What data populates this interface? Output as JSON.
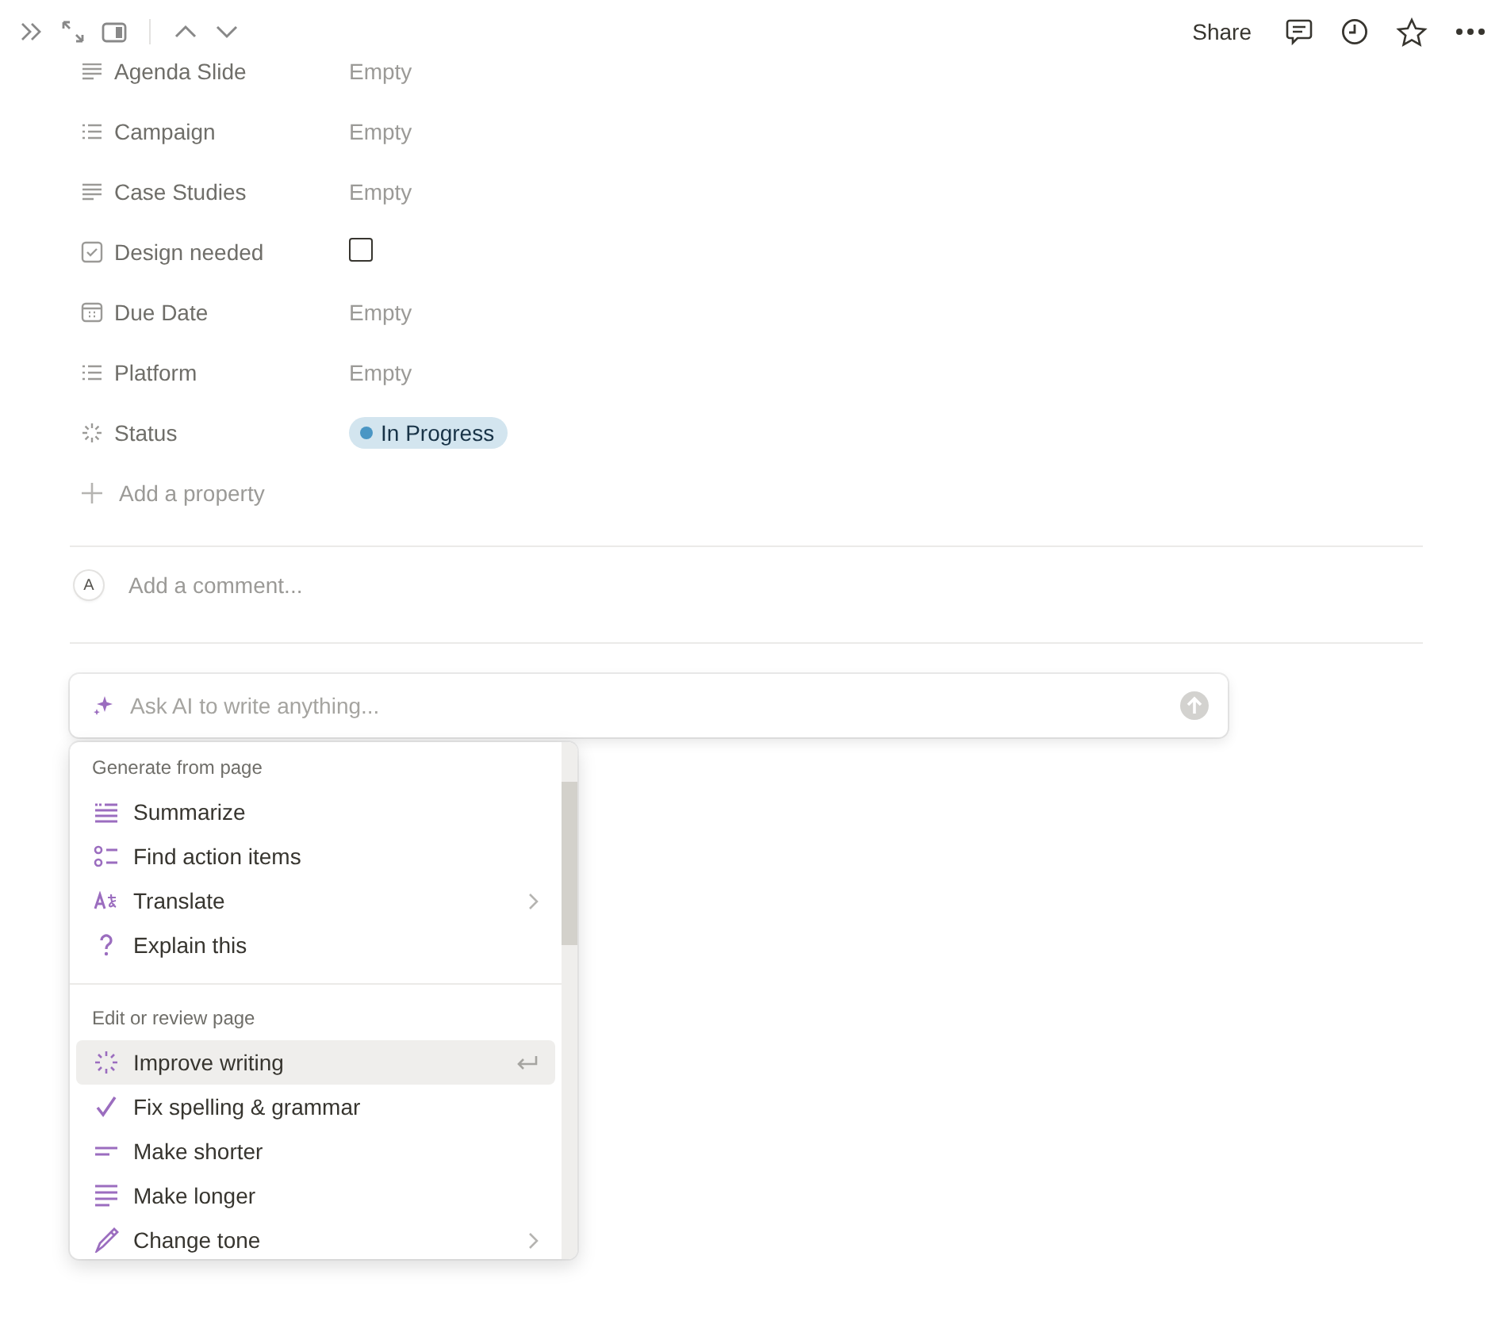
{
  "toolbar": {
    "share": "Share"
  },
  "properties": [
    {
      "name": "Agenda Slide",
      "kind": "text",
      "value": "Empty"
    },
    {
      "name": "Campaign",
      "kind": "multi_select",
      "value": "Empty"
    },
    {
      "name": "Case Studies",
      "kind": "text",
      "value": "Empty"
    },
    {
      "name": "Design needed",
      "kind": "checkbox",
      "checked": false
    },
    {
      "name": "Due Date",
      "kind": "date",
      "value": "Empty"
    },
    {
      "name": "Platform",
      "kind": "multi_select",
      "value": "Empty"
    },
    {
      "name": "Status",
      "kind": "status",
      "value": "In Progress",
      "color": "#4a96c4"
    }
  ],
  "add_property": "Add a property",
  "comment": {
    "avatar": "A",
    "placeholder": "Add a comment..."
  },
  "ai_input": {
    "placeholder": "Ask AI to write anything..."
  },
  "menu": {
    "sections": [
      {
        "heading": "Generate from page",
        "items": [
          {
            "label": "Summarize",
            "submenu": false,
            "selected": false
          },
          {
            "label": "Find action items",
            "submenu": false,
            "selected": false
          },
          {
            "label": "Translate",
            "submenu": true,
            "selected": false
          },
          {
            "label": "Explain this",
            "submenu": false,
            "selected": false
          }
        ]
      },
      {
        "heading": "Edit or review page",
        "items": [
          {
            "label": "Improve writing",
            "submenu": false,
            "selected": true
          },
          {
            "label": "Fix spelling & grammar",
            "submenu": false,
            "selected": false
          },
          {
            "label": "Make shorter",
            "submenu": false,
            "selected": false
          },
          {
            "label": "Make longer",
            "submenu": false,
            "selected": false
          },
          {
            "label": "Change tone",
            "submenu": true,
            "selected": false
          }
        ]
      }
    ]
  }
}
